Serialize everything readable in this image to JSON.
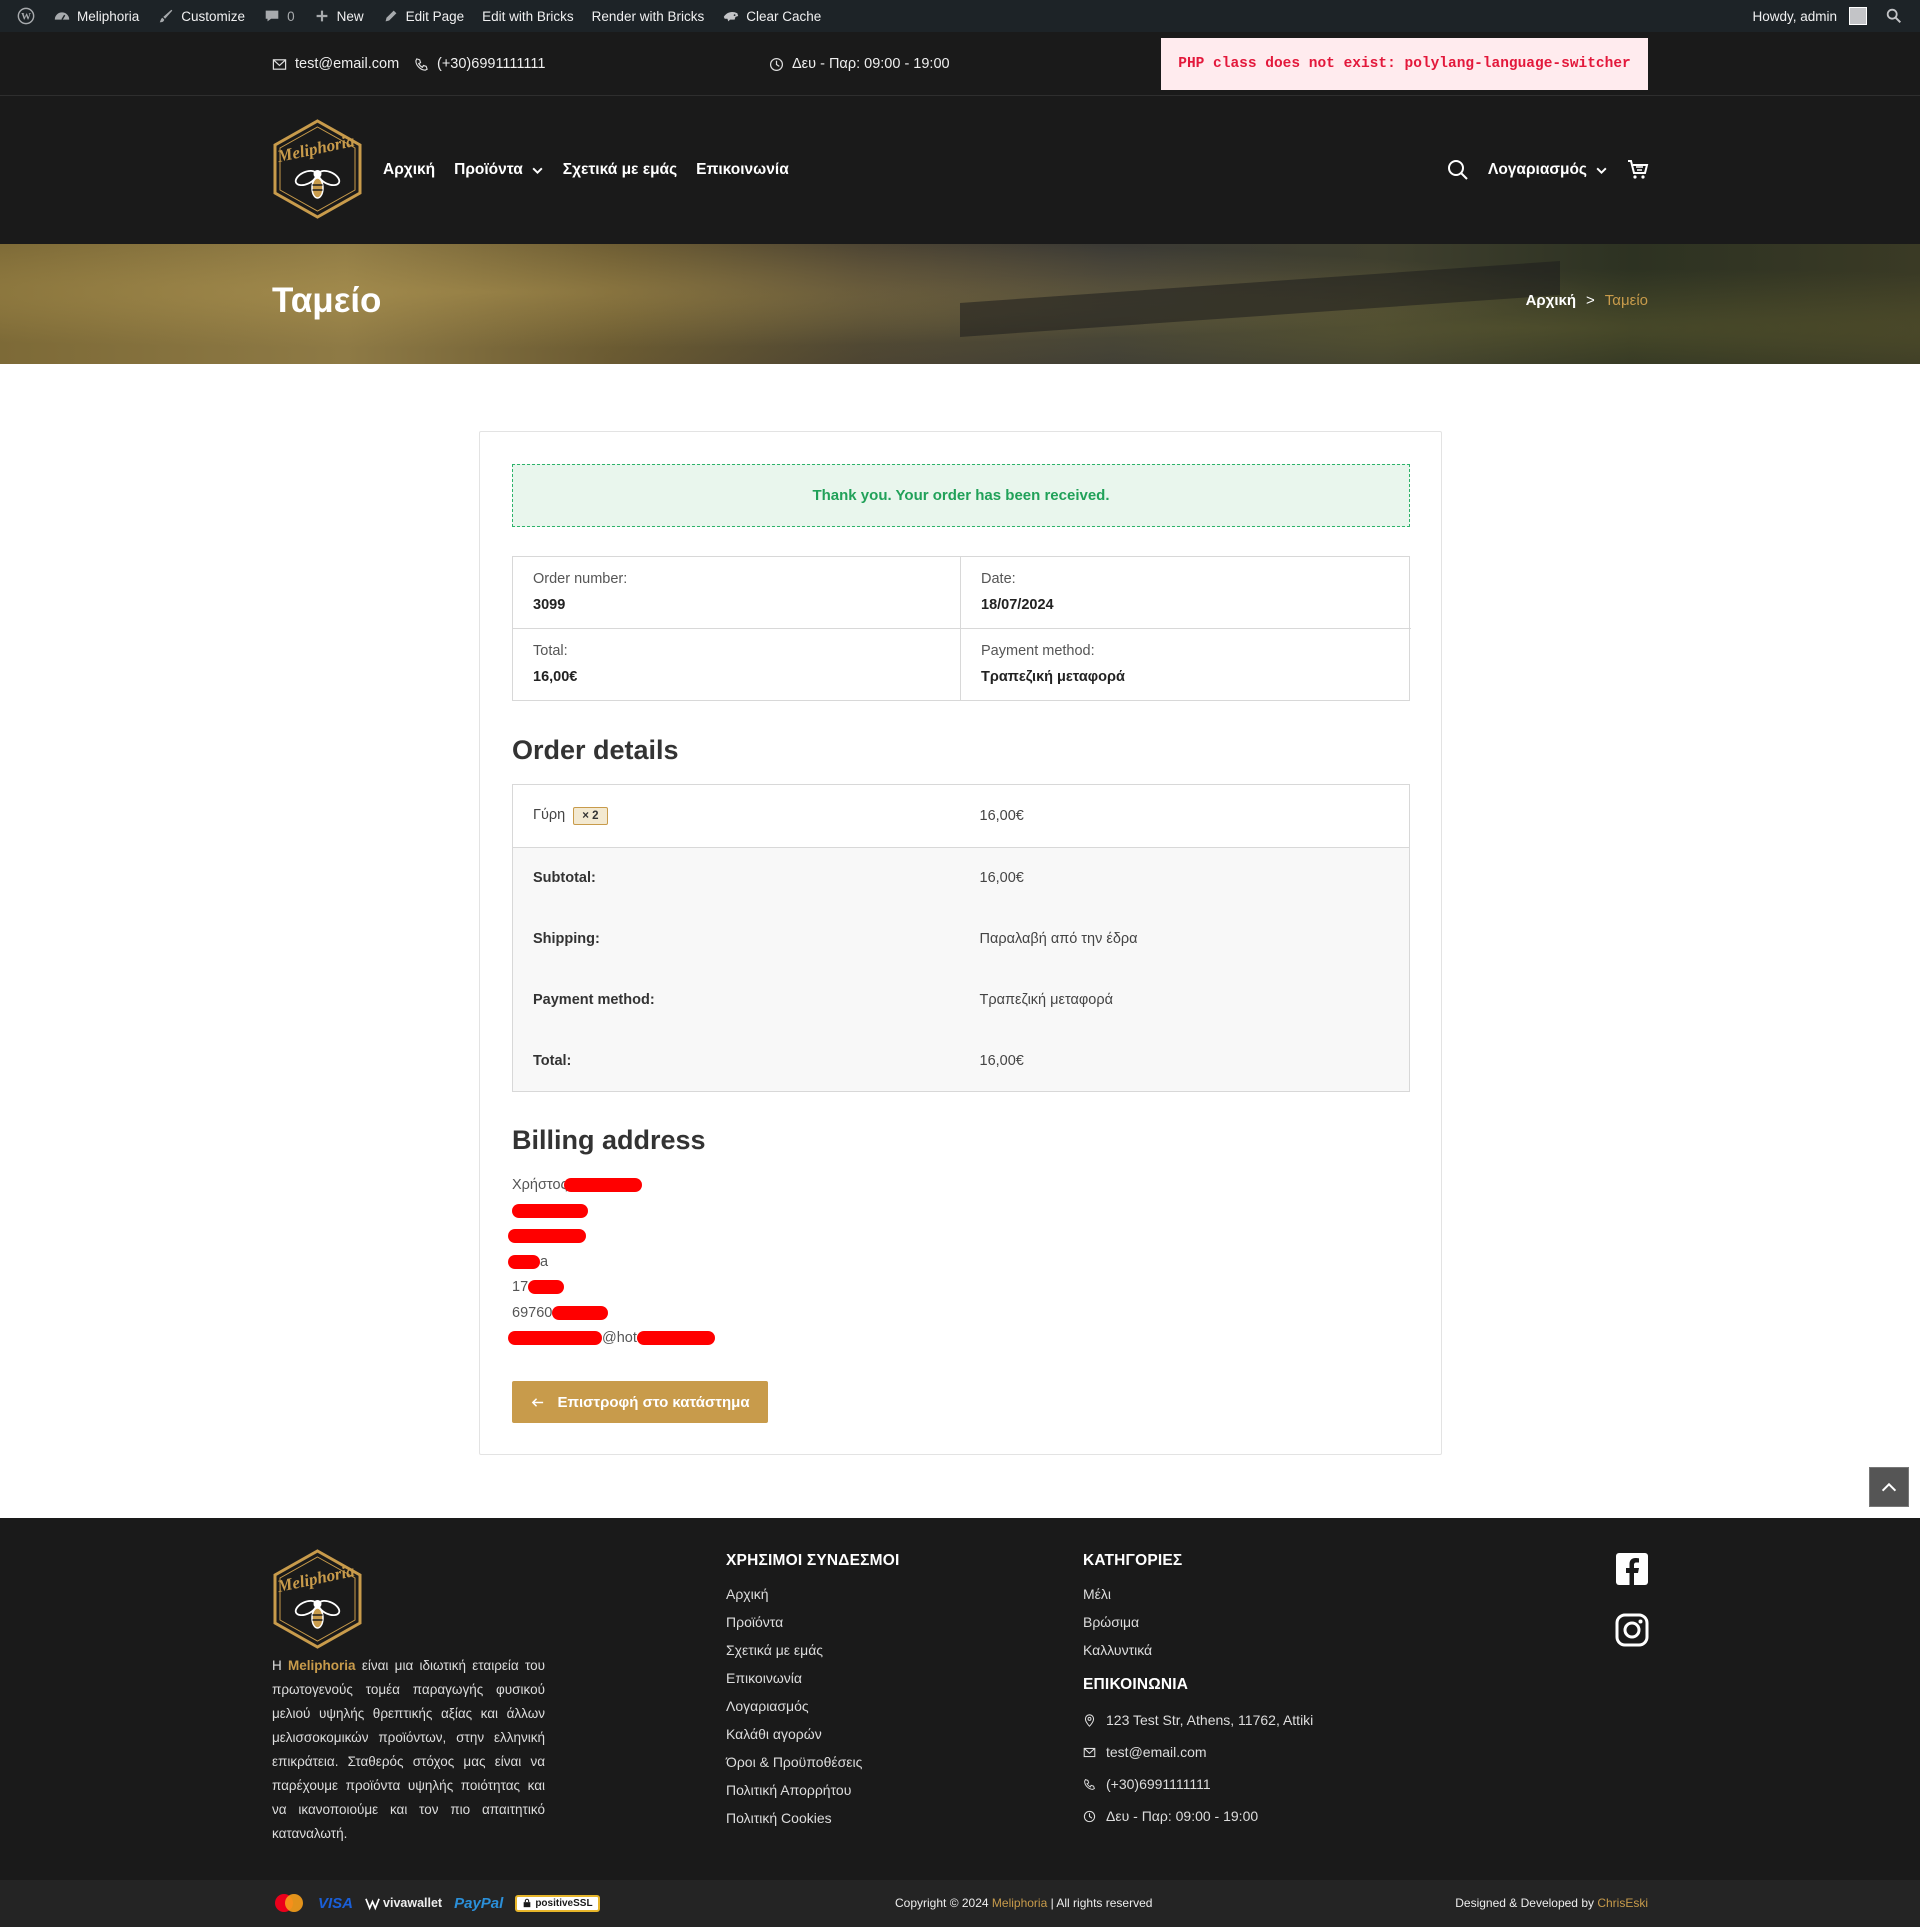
{
  "adminbar": {
    "site": "Meliphoria",
    "customize": "Customize",
    "comments": "0",
    "new": "New",
    "edit_page": "Edit Page",
    "edit_bricks": "Edit with Bricks",
    "render_bricks": "Render with Bricks",
    "clear_cache": "Clear Cache",
    "howdy": "Howdy, admin"
  },
  "topbar": {
    "email": "test@email.com",
    "phone": "(+30)6991111111",
    "hours": "Δευ - Παρ: 09:00 - 19:00",
    "error": "PHP class does not exist: polylang-language-switcher"
  },
  "nav": {
    "items": [
      "Αρχική",
      "Προϊόντα",
      "Σχετικά με εμάς",
      "Επικοινωνία"
    ],
    "account": "Λογαριασμός",
    "logo_text": "Meliphoria"
  },
  "hero": {
    "title": "Ταμείο",
    "breadcrumb_home": "Αρχική",
    "breadcrumb_sep": ">",
    "breadcrumb_current": "Ταμείο"
  },
  "order": {
    "notice": "Thank you. Your order has been received.",
    "number_label": "Order number:",
    "number": "3099",
    "date_label": "Date:",
    "date": "18/07/2024",
    "total_label": "Total:",
    "total": "16,00€",
    "payment_label": "Payment method:",
    "payment": "Τραπεζική μεταφορά",
    "details_title": "Order details",
    "product_name": "Γύρη",
    "product_qty": "× 2",
    "product_total": "16,00€",
    "subtotal_label": "Subtotal:",
    "subtotal": "16,00€",
    "shipping_label": "Shipping:",
    "shipping": "Παραλαβή από την έδρα",
    "pm_label": "Payment method:",
    "pm": "Τραπεζική μεταφορά",
    "grand_total_label": "Total:",
    "grand_total": "16,00€",
    "billing_title": "Billing address",
    "billing_name": "Χρήστος",
    "billing_line_city": "a",
    "billing_zip": "17",
    "billing_phone": "69760",
    "billing_email": "@hot",
    "back_button": "Επιστροφή στο κατάστημα"
  },
  "footer": {
    "about_brand": "Meliphoria",
    "about_pre": "Η ",
    "about_text": " είναι μια ιδιωτική εταιρεία του πρωτογενούς τομέα παραγωγής φυσικού μελιού υψηλής θρεπτικής αξίας και άλλων μελισσοκομικών προϊόντων, στην ελληνική επικράτεια. Σταθερός στόχος μας είναι να παρέχουμε προϊόντα υψηλής ποιότητας και να ικανοποιούμε και τον πιο απαιτητικό καταναλωτή.",
    "links_title": "ΧΡΗΣΙΜΟΙ ΣΥΝΔΕΣΜΟΙ",
    "links": [
      "Αρχική",
      "Προϊόντα",
      "Σχετικά με εμάς",
      "Επικοινωνία",
      "Λογαριασμός",
      "Καλάθι αγορών",
      "Όροι & Προϋποθέσεις",
      "Πολιτική Απορρήτου",
      "Πολιτική Cookies"
    ],
    "categories_title": "ΚΑΤΗΓΟΡΙΕΣ",
    "categories": [
      "Μέλι",
      "Βρώσιμα",
      "Καλλυντικά"
    ],
    "contact_title": "ΕΠΙΚΟΙΝΩΝΙΑ",
    "address": "123 Test Str, Athens, 11762, Attiki",
    "email": "test@email.com",
    "phone": "(+30)6991111111",
    "hours": "Δευ - Παρ: 09:00 - 19:00"
  },
  "bottombar": {
    "pay_visa": "VISA",
    "pay_viva": "vivawallet",
    "pay_paypal": "PayPal",
    "pay_ssl": "positiveSSL",
    "copyright_pre": "Copyright © 2024 ",
    "copyright_brand": "Meliphoria",
    "copyright_post": " | All rights reserved",
    "credit_pre": "Designed & Developed by ",
    "credit_brand": "ChrisEski"
  },
  "colors": {
    "accent": "#c89b4b",
    "dark": "#1a1a1a",
    "success": "#21a159",
    "error": "#e3183b"
  }
}
